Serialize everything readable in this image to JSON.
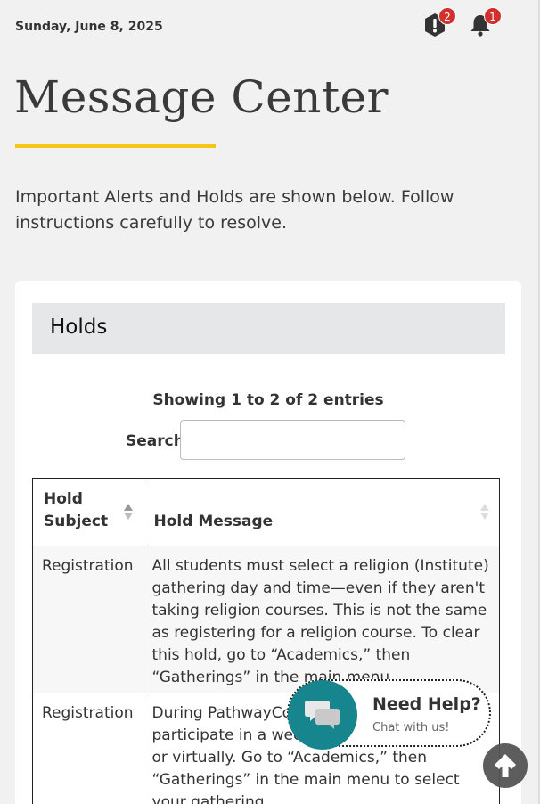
{
  "header": {
    "date": "Sunday, June 8, 2025",
    "alerts_badge": "2",
    "notifications_badge": "1"
  },
  "page": {
    "title": "Message Center",
    "intro": "Important Alerts and Holds are shown below. Follow instructions carefully to resolve."
  },
  "holds": {
    "title": "Holds",
    "showing": "Showing 1 to 2 of 2 entries",
    "search_label": "Search",
    "search_value": "",
    "columns": [
      "Hold Subject",
      "Hold Message"
    ],
    "rows": [
      {
        "subject": "Registration",
        "message": "All students must select a religion (Institute) gathering day and time—even if they aren't taking religion courses. This is not the same as registering for a religion course. To clear this hold, go to “Academics,” then “Gatherings” in the main menu."
      },
      {
        "subject": "Registration",
        "message": "During PathwayConnect, you must participate in a weekly gathering in person or virtually. Go to “Academics,” then “Gatherings” in the main menu to select your gathering."
      }
    ]
  },
  "help": {
    "title": "Need Help?",
    "subtitle": "Chat with us!"
  },
  "colors": {
    "accent": "#f5c518",
    "badge": "#d0312d",
    "help_teal": "#16858e"
  }
}
